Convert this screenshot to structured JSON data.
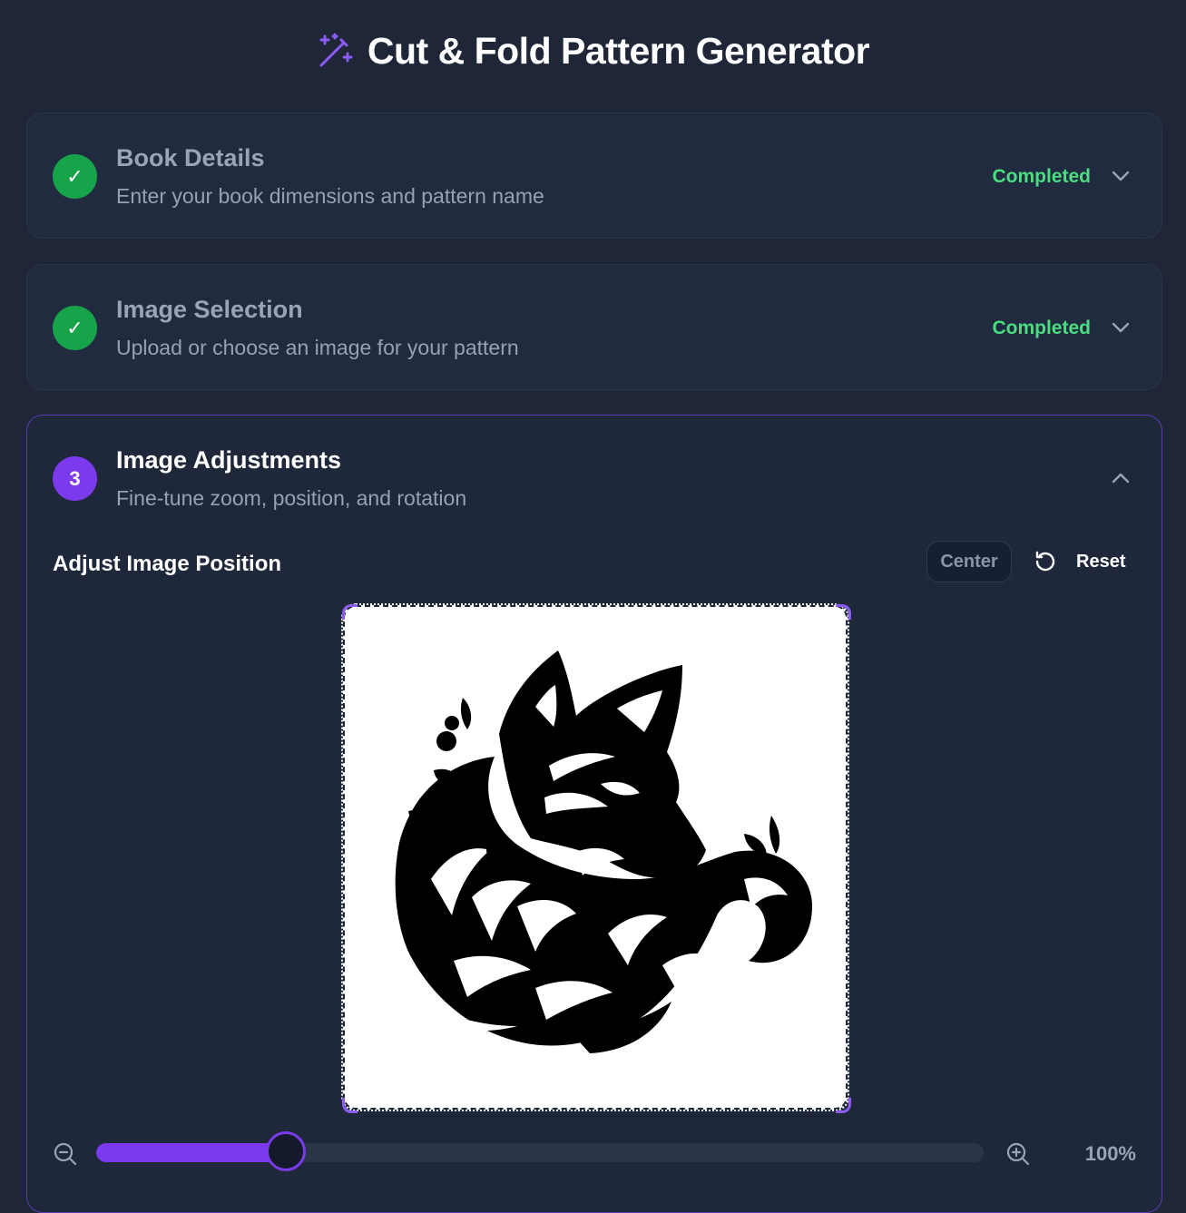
{
  "app": {
    "title": "Cut & Fold Pattern Generator",
    "icon": "magic-wand-icon",
    "accent": "#7c3aed"
  },
  "steps": [
    {
      "badge": "✓",
      "title": "Book Details",
      "subtitle": "Enter your book dimensions and pattern name",
      "status": "Completed",
      "expanded": false
    },
    {
      "badge": "✓",
      "title": "Image Selection",
      "subtitle": "Upload or choose an image for your pattern",
      "status": "Completed",
      "expanded": false
    },
    {
      "badge": "3",
      "title": "Image Adjustments",
      "subtitle": "Fine-tune zoom, position, and rotation",
      "status": "",
      "expanded": true
    }
  ],
  "adjust": {
    "title": "Adjust Image Position",
    "center_label": "Center",
    "reset_label": "Reset",
    "image_alt": "tribal wolf illustration"
  },
  "zoom": {
    "value_label": "100%",
    "slider_fraction": 0.214
  }
}
